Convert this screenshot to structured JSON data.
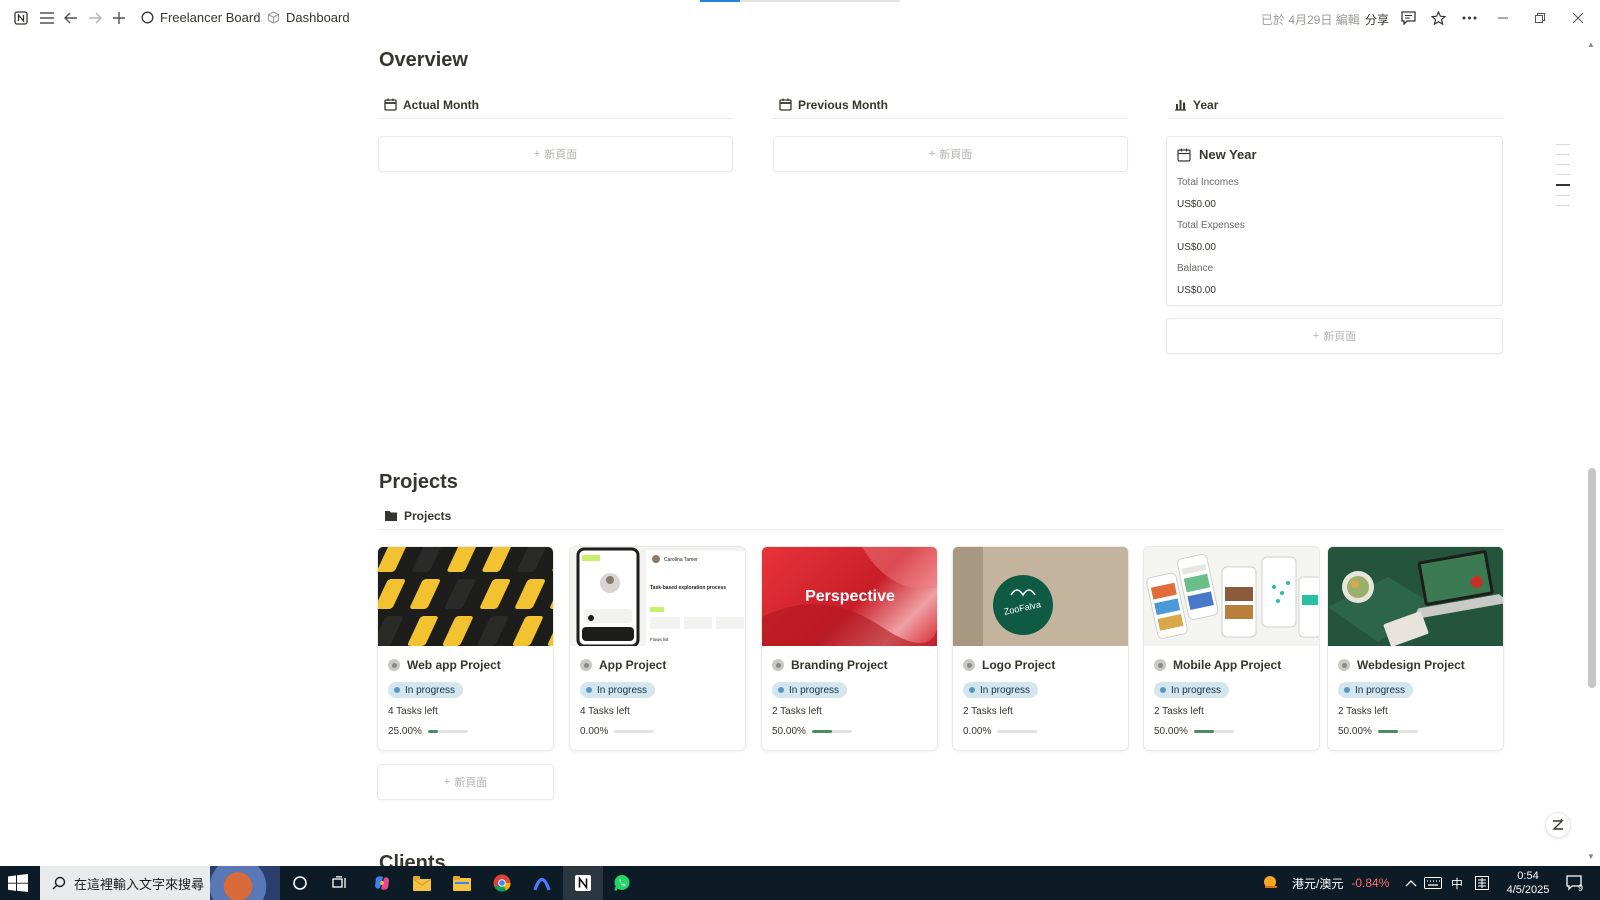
{
  "topbar": {
    "workspace": "Freelancer Board",
    "page": "Dashboard",
    "edited": "已於 4月29日 編輯",
    "share": "分享"
  },
  "overview": {
    "title": "Overview",
    "columns": [
      {
        "label": "Actual Month",
        "icon": "calendar-icon"
      },
      {
        "label": "Previous Month",
        "icon": "calendar-icon"
      },
      {
        "label": "Year",
        "icon": "bar-chart-icon"
      }
    ],
    "new_page": "新頁面",
    "year_card": {
      "title": "New Year",
      "total_incomes_label": "Total Incomes",
      "total_incomes": "US$0.00",
      "total_expenses_label": "Total Expenses",
      "total_expenses": "US$0.00",
      "balance_label": "Balance",
      "balance": "US$0.00"
    }
  },
  "projects": {
    "title": "Projects",
    "view_label": "Projects",
    "new_page": "新頁面",
    "items": [
      {
        "name": "Web app Project",
        "status": "In progress",
        "tasks": "4 Tasks left",
        "progress_text": "25.00%",
        "progress": 0.25,
        "cover": "yellow-phones"
      },
      {
        "name": "App Project",
        "status": "In progress",
        "tasks": "4 Tasks left",
        "progress_text": "0.00%",
        "progress": 0.0,
        "cover": "app-ui"
      },
      {
        "name": "Branding Project",
        "status": "In progress",
        "tasks": "2 Tasks left",
        "progress_text": "50.00%",
        "progress": 0.5,
        "cover": "red-perspective"
      },
      {
        "name": "Logo Project",
        "status": "In progress",
        "tasks": "2 Tasks left",
        "progress_text": "0.00%",
        "progress": 0.0,
        "cover": "logo-sticker"
      },
      {
        "name": "Mobile App Project",
        "status": "In progress",
        "tasks": "2 Tasks left",
        "progress_text": "50.00%",
        "progress": 0.5,
        "cover": "mobile-screens"
      },
      {
        "name": "Webdesign Project",
        "status": "In progress",
        "tasks": "2 Tasks left",
        "progress_text": "50.00%",
        "progress": 0.5,
        "cover": "laptop-green"
      }
    ],
    "cover_texts": {
      "branding": "Perspective",
      "logo": "ZooFalva",
      "app_heading": "Task-based exploration process",
      "app_user": "Carolina Tamer",
      "app_flows": "Flows list"
    }
  },
  "clients": {
    "title": "Clients"
  },
  "taskbar": {
    "search_placeholder": "在這裡輸入文字來搜尋",
    "currency": "港元/澳元",
    "currency_change": "-0.84%",
    "ime": "中",
    "time": "0:54",
    "date": "4/5/2025",
    "notifications": "9"
  },
  "colors": {
    "progress_fill": "#4c8b5f",
    "badge_bg": "#d3e5ef",
    "currency_down": "#ff6b6b",
    "taskbar_bg": "#0d1b26"
  }
}
